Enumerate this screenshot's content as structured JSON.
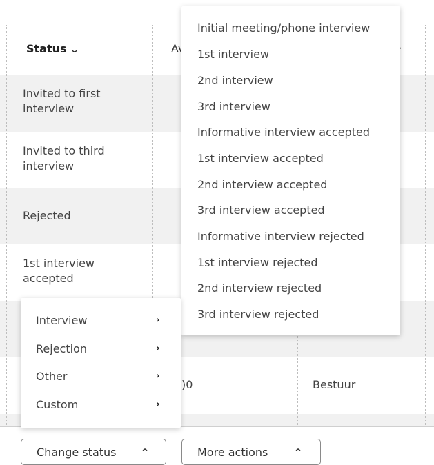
{
  "table": {
    "header": {
      "status": "Status",
      "col2_partial": "Av"
    },
    "rows": [
      {
        "status": "Invited to first interview"
      },
      {
        "status": "Invited to third interview"
      },
      {
        "status": "Rejected"
      },
      {
        "status": "1st interview accepted"
      },
      {
        "status": ""
      },
      {
        "status": "",
        "col2_partial": ")0",
        "col3": "Bestuur"
      }
    ]
  },
  "submenu_interview": [
    "Initial meeting/phone interview",
    "1st interview",
    "2nd interview",
    "3rd interview",
    "Informative interview accepted",
    "1st interview accepted",
    "2nd interview accepted",
    "3rd interview accepted",
    "Informative interview rejected",
    "1st interview rejected",
    "2nd interview rejected",
    "3rd interview rejected"
  ],
  "status_menu": [
    {
      "label": "Interview"
    },
    {
      "label": "Rejection"
    },
    {
      "label": "Other"
    },
    {
      "label": "Custom"
    }
  ],
  "icons": {
    "chevron_down": "chevron-down-icon",
    "chevron_right": "chevron-right-icon",
    "chevron_up": "chevron-up-icon"
  },
  "glyphs": {
    "down": "⌄",
    "right": "›",
    "up": "⌃"
  },
  "actions": {
    "change_status": "Change status",
    "more_actions": "More actions"
  }
}
